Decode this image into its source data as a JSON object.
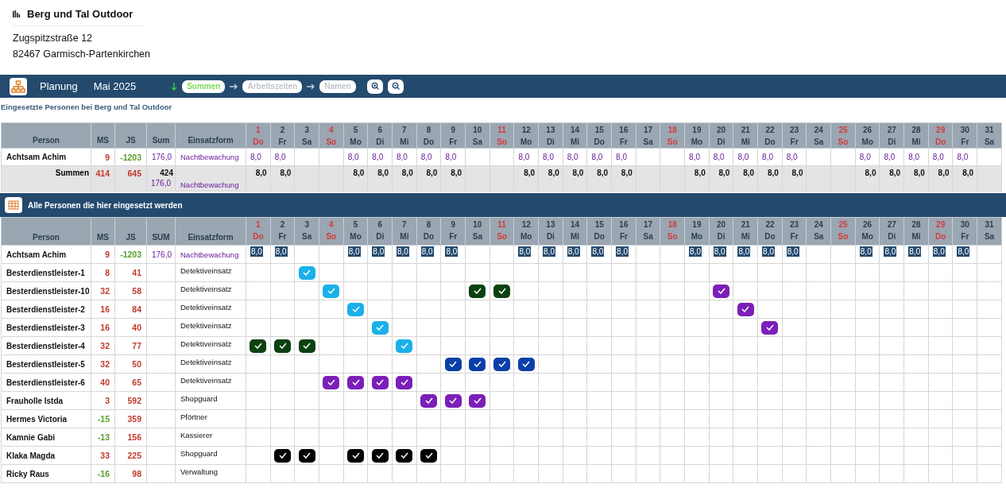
{
  "company": {
    "name": "Berg und Tal Outdoor",
    "address": [
      "Zugspitzstraße 12",
      "82467 Garmisch-Partenkirchen"
    ]
  },
  "toolbar": {
    "title": "Planung",
    "period": "Mai 2025",
    "steps": [
      {
        "label": "Summen",
        "selected": true
      },
      {
        "label": "Arbeitszeiten",
        "selected": false
      },
      {
        "label": "Namen",
        "selected": false
      }
    ]
  },
  "subtitle": "Eingesetzte Personen bei Berg und Tal Outdoor",
  "table1": {
    "columns": [
      "Person",
      "MS",
      "JS",
      "Sum",
      "Einsatzform"
    ],
    "days": [
      {
        "num": "1",
        "weekday": "Do",
        "holiday": true
      },
      {
        "num": "2",
        "weekday": "Fr",
        "holiday": false
      },
      {
        "num": "3",
        "weekday": "Sa",
        "holiday": false
      },
      {
        "num": "4",
        "weekday": "So",
        "holiday": true
      },
      {
        "num": "5",
        "weekday": "Mo",
        "holiday": false
      },
      {
        "num": "6",
        "weekday": "Di",
        "holiday": false
      },
      {
        "num": "7",
        "weekday": "Mi",
        "holiday": false
      },
      {
        "num": "8",
        "weekday": "Do",
        "holiday": false
      },
      {
        "num": "9",
        "weekday": "Fr",
        "holiday": false
      },
      {
        "num": "10",
        "weekday": "Sa",
        "holiday": false
      },
      {
        "num": "11",
        "weekday": "So",
        "holiday": true
      },
      {
        "num": "12",
        "weekday": "Mo",
        "holiday": false
      },
      {
        "num": "13",
        "weekday": "Di",
        "holiday": false
      },
      {
        "num": "14",
        "weekday": "Mi",
        "holiday": false
      },
      {
        "num": "15",
        "weekday": "Do",
        "holiday": false
      },
      {
        "num": "16",
        "weekday": "Fr",
        "holiday": false
      },
      {
        "num": "17",
        "weekday": "Sa",
        "holiday": false
      },
      {
        "num": "18",
        "weekday": "So",
        "holiday": true
      },
      {
        "num": "19",
        "weekday": "Mo",
        "holiday": false
      },
      {
        "num": "20",
        "weekday": "Di",
        "holiday": false
      },
      {
        "num": "21",
        "weekday": "Mi",
        "holiday": false
      },
      {
        "num": "22",
        "weekday": "Do",
        "holiday": false
      },
      {
        "num": "23",
        "weekday": "Fr",
        "holiday": false
      },
      {
        "num": "24",
        "weekday": "Sa",
        "holiday": false
      },
      {
        "num": "25",
        "weekday": "So",
        "holiday": true
      },
      {
        "num": "26",
        "weekday": "Mo",
        "holiday": false
      },
      {
        "num": "27",
        "weekday": "Di",
        "holiday": false
      },
      {
        "num": "28",
        "weekday": "Mi",
        "holiday": false
      },
      {
        "num": "29",
        "weekday": "Do",
        "holiday": true
      },
      {
        "num": "30",
        "weekday": "Fr",
        "holiday": false
      },
      {
        "num": "31",
        "weekday": "Sa",
        "holiday": false
      }
    ],
    "rows": [
      {
        "person": "Achtsam Achim",
        "ms": "9",
        "ms_negative": false,
        "js": "-1203",
        "js_negative": true,
        "sum": "176,0",
        "form": "Nachtbewachung",
        "cells": [
          {
            "kind": "hours",
            "text": "8,0"
          },
          {
            "kind": "hours",
            "text": "8,0"
          },
          {
            "kind": "empty"
          },
          {
            "kind": "empty"
          },
          {
            "kind": "hours",
            "text": "8,0"
          },
          {
            "kind": "hours",
            "text": "8,0"
          },
          {
            "kind": "hours",
            "text": "8,0"
          },
          {
            "kind": "hours",
            "text": "8,0"
          },
          {
            "kind": "hours",
            "text": "8,0"
          },
          {
            "kind": "empty"
          },
          {
            "kind": "empty"
          },
          {
            "kind": "hours",
            "text": "8,0"
          },
          {
            "kind": "hours",
            "text": "8,0"
          },
          {
            "kind": "hours",
            "text": "8,0"
          },
          {
            "kind": "hours",
            "text": "8,0"
          },
          {
            "kind": "hours",
            "text": "8,0"
          },
          {
            "kind": "empty"
          },
          {
            "kind": "empty"
          },
          {
            "kind": "hours",
            "text": "8,0"
          },
          {
            "kind": "hours",
            "text": "8,0"
          },
          {
            "kind": "hours",
            "text": "8,0"
          },
          {
            "kind": "hours",
            "text": "8,0"
          },
          {
            "kind": "hours",
            "text": "8,0"
          },
          {
            "kind": "empty"
          },
          {
            "kind": "empty"
          },
          {
            "kind": "hours",
            "text": "8,0"
          },
          {
            "kind": "hours",
            "text": "8,0"
          },
          {
            "kind": "hours",
            "text": "8,0"
          },
          {
            "kind": "hours",
            "text": "8,0"
          },
          {
            "kind": "hours",
            "text": "8,0"
          },
          {
            "kind": "empty"
          }
        ]
      }
    ],
    "totals": {
      "label": "Summen",
      "ms": "414",
      "js": "645",
      "sum": "424",
      "sum_hours": "176,0",
      "form": "Nachtbewachung",
      "cells": [
        {
          "kind": "total",
          "text": "8,0"
        },
        {
          "kind": "total",
          "text": "8,0"
        },
        {
          "kind": "empty"
        },
        {
          "kind": "empty"
        },
        {
          "kind": "total",
          "text": "8,0"
        },
        {
          "kind": "total",
          "text": "8,0"
        },
        {
          "kind": "total",
          "text": "8,0"
        },
        {
          "kind": "total",
          "text": "8,0"
        },
        {
          "kind": "total",
          "text": "8,0"
        },
        {
          "kind": "empty"
        },
        {
          "kind": "empty"
        },
        {
          "kind": "total",
          "text": "8,0"
        },
        {
          "kind": "total",
          "text": "8,0"
        },
        {
          "kind": "total",
          "text": "8,0"
        },
        {
          "kind": "total",
          "text": "8,0"
        },
        {
          "kind": "total",
          "text": "8,0"
        },
        {
          "kind": "empty"
        },
        {
          "kind": "empty"
        },
        {
          "kind": "total",
          "text": "8,0"
        },
        {
          "kind": "total",
          "text": "8,0"
        },
        {
          "kind": "total",
          "text": "8,0"
        },
        {
          "kind": "total",
          "text": "8,0"
        },
        {
          "kind": "total",
          "text": "8,0"
        },
        {
          "kind": "empty"
        },
        {
          "kind": "empty"
        },
        {
          "kind": "total",
          "text": "8,0"
        },
        {
          "kind": "total",
          "text": "8,0"
        },
        {
          "kind": "total",
          "text": "8,0"
        },
        {
          "kind": "total",
          "text": "8,0"
        },
        {
          "kind": "total",
          "text": "8,0"
        },
        {
          "kind": "empty"
        }
      ]
    }
  },
  "section": {
    "title": "Alle Personen die hier eingesetzt werden"
  },
  "table2": {
    "columns": [
      "Person",
      "MS",
      "JS",
      "SUM",
      "Einsatzform"
    ],
    "days": [
      {
        "num": "1",
        "weekday": "Do",
        "holiday": true
      },
      {
        "num": "2",
        "weekday": "Fr",
        "holiday": false
      },
      {
        "num": "3",
        "weekday": "Sa",
        "holiday": false
      },
      {
        "num": "4",
        "weekday": "So",
        "holiday": true
      },
      {
        "num": "5",
        "weekday": "Mo",
        "holiday": false
      },
      {
        "num": "6",
        "weekday": "Di",
        "holiday": false
      },
      {
        "num": "7",
        "weekday": "Mi",
        "holiday": false
      },
      {
        "num": "8",
        "weekday": "Do",
        "holiday": false
      },
      {
        "num": "9",
        "weekday": "Fr",
        "holiday": false
      },
      {
        "num": "10",
        "weekday": "Sa",
        "holiday": false
      },
      {
        "num": "11",
        "weekday": "So",
        "holiday": true
      },
      {
        "num": "12",
        "weekday": "Mo",
        "holiday": false
      },
      {
        "num": "13",
        "weekday": "Di",
        "holiday": false
      },
      {
        "num": "14",
        "weekday": "Mi",
        "holiday": false
      },
      {
        "num": "15",
        "weekday": "Do",
        "holiday": false
      },
      {
        "num": "16",
        "weekday": "Fr",
        "holiday": false
      },
      {
        "num": "17",
        "weekday": "Sa",
        "holiday": false
      },
      {
        "num": "18",
        "weekday": "So",
        "holiday": true
      },
      {
        "num": "19",
        "weekday": "Mo",
        "holiday": false
      },
      {
        "num": "20",
        "weekday": "Di",
        "holiday": false
      },
      {
        "num": "21",
        "weekday": "Mi",
        "holiday": false
      },
      {
        "num": "22",
        "weekday": "Do",
        "holiday": false
      },
      {
        "num": "23",
        "weekday": "Fr",
        "holiday": false
      },
      {
        "num": "24",
        "weekday": "Sa",
        "holiday": false
      },
      {
        "num": "25",
        "weekday": "So",
        "holiday": true
      },
      {
        "num": "26",
        "weekday": "Mo",
        "holiday": false
      },
      {
        "num": "27",
        "weekday": "Di",
        "holiday": false
      },
      {
        "num": "28",
        "weekday": "Mi",
        "holiday": false
      },
      {
        "num": "29",
        "weekday": "Do",
        "holiday": true
      },
      {
        "num": "30",
        "weekday": "Fr",
        "holiday": false
      },
      {
        "num": "31",
        "weekday": "Sa",
        "holiday": false
      }
    ],
    "rows": [
      {
        "person": "Achtsam Achim",
        "ms": "9",
        "ms_negative": false,
        "js": "-1203",
        "js_negative": true,
        "sum": "176,0",
        "form": "Nachtbewachung",
        "cells": [
          {
            "kind": "badge",
            "text": "8,0"
          },
          {
            "kind": "badge",
            "text": "8,0"
          },
          {
            "kind": "empty"
          },
          {
            "kind": "empty"
          },
          {
            "kind": "badge",
            "text": "8,0"
          },
          {
            "kind": "badge",
            "text": "8,0"
          },
          {
            "kind": "badge",
            "text": "8,0"
          },
          {
            "kind": "badge",
            "text": "8,0"
          },
          {
            "kind": "badge",
            "text": "8,0"
          },
          {
            "kind": "empty"
          },
          {
            "kind": "empty"
          },
          {
            "kind": "badge",
            "text": "8,0"
          },
          {
            "kind": "badge",
            "text": "8,0"
          },
          {
            "kind": "badge",
            "text": "8,0"
          },
          {
            "kind": "badge",
            "text": "8,0"
          },
          {
            "kind": "badge",
            "text": "8,0"
          },
          {
            "kind": "empty"
          },
          {
            "kind": "empty"
          },
          {
            "kind": "badge",
            "text": "8,0"
          },
          {
            "kind": "badge",
            "text": "8,0"
          },
          {
            "kind": "badge",
            "text": "8,0"
          },
          {
            "kind": "badge",
            "text": "8,0"
          },
          {
            "kind": "badge",
            "text": "8,0"
          },
          {
            "kind": "empty"
          },
          {
            "kind": "empty"
          },
          {
            "kind": "badge",
            "text": "8,0"
          },
          {
            "kind": "badge",
            "text": "8,0"
          },
          {
            "kind": "badge",
            "text": "8,0"
          },
          {
            "kind": "badge",
            "text": "8,0"
          },
          {
            "kind": "badge",
            "text": "8,0"
          },
          {
            "kind": "empty"
          }
        ]
      },
      {
        "person": "Besterdienstleister-1",
        "ms": "8",
        "ms_negative": false,
        "js": "41",
        "js_negative": false,
        "form": "Detektiveinsatz",
        "cells": [
          {
            "kind": "empty"
          },
          {
            "kind": "empty"
          },
          {
            "kind": "check",
            "color": "#1ab0ea"
          },
          {
            "kind": "empty"
          },
          {
            "kind": "empty"
          },
          {
            "kind": "empty"
          },
          {
            "kind": "empty"
          },
          {
            "kind": "empty"
          },
          {
            "kind": "empty"
          },
          {
            "kind": "empty"
          },
          {
            "kind": "empty"
          },
          {
            "kind": "empty"
          },
          {
            "kind": "empty"
          },
          {
            "kind": "empty"
          },
          {
            "kind": "empty"
          },
          {
            "kind": "empty"
          },
          {
            "kind": "empty"
          },
          {
            "kind": "empty"
          },
          {
            "kind": "empty"
          },
          {
            "kind": "empty"
          },
          {
            "kind": "empty"
          },
          {
            "kind": "empty"
          },
          {
            "kind": "empty"
          },
          {
            "kind": "empty"
          },
          {
            "kind": "empty"
          },
          {
            "kind": "empty"
          },
          {
            "kind": "empty"
          },
          {
            "kind": "empty"
          },
          {
            "kind": "empty"
          },
          {
            "kind": "empty"
          },
          {
            "kind": "empty"
          }
        ]
      },
      {
        "person": "Besterdienstleister-10",
        "ms": "32",
        "ms_negative": false,
        "js": "58",
        "js_negative": false,
        "form": "Detektiveinsatz",
        "cells": [
          {
            "kind": "empty"
          },
          {
            "kind": "empty"
          },
          {
            "kind": "empty"
          },
          {
            "kind": "check",
            "color": "#1ab0ea"
          },
          {
            "kind": "empty"
          },
          {
            "kind": "empty"
          },
          {
            "kind": "empty"
          },
          {
            "kind": "empty"
          },
          {
            "kind": "empty"
          },
          {
            "kind": "check",
            "color": "#0b4210"
          },
          {
            "kind": "check",
            "color": "#0b4210"
          },
          {
            "kind": "empty"
          },
          {
            "kind": "empty"
          },
          {
            "kind": "empty"
          },
          {
            "kind": "empty"
          },
          {
            "kind": "empty"
          },
          {
            "kind": "empty"
          },
          {
            "kind": "empty"
          },
          {
            "kind": "empty"
          },
          {
            "kind": "check",
            "color": "#7b1fb8"
          },
          {
            "kind": "empty"
          },
          {
            "kind": "empty"
          },
          {
            "kind": "empty"
          },
          {
            "kind": "empty"
          },
          {
            "kind": "empty"
          },
          {
            "kind": "empty"
          },
          {
            "kind": "empty"
          },
          {
            "kind": "empty"
          },
          {
            "kind": "empty"
          },
          {
            "kind": "empty"
          },
          {
            "kind": "empty"
          }
        ]
      },
      {
        "person": "Besterdienstleister-2",
        "ms": "16",
        "ms_negative": false,
        "js": "84",
        "js_negative": false,
        "form": "Detektiveinsatz",
        "cells": [
          {
            "kind": "empty"
          },
          {
            "kind": "empty"
          },
          {
            "kind": "empty"
          },
          {
            "kind": "empty"
          },
          {
            "kind": "check",
            "color": "#1ab0ea"
          },
          {
            "kind": "empty"
          },
          {
            "kind": "empty"
          },
          {
            "kind": "empty"
          },
          {
            "kind": "empty"
          },
          {
            "kind": "empty"
          },
          {
            "kind": "empty"
          },
          {
            "kind": "empty"
          },
          {
            "kind": "empty"
          },
          {
            "kind": "empty"
          },
          {
            "kind": "empty"
          },
          {
            "kind": "empty"
          },
          {
            "kind": "empty"
          },
          {
            "kind": "empty"
          },
          {
            "kind": "empty"
          },
          {
            "kind": "empty"
          },
          {
            "kind": "check",
            "color": "#7b1fb8"
          },
          {
            "kind": "empty"
          },
          {
            "kind": "empty"
          },
          {
            "kind": "empty"
          },
          {
            "kind": "empty"
          },
          {
            "kind": "empty"
          },
          {
            "kind": "empty"
          },
          {
            "kind": "empty"
          },
          {
            "kind": "empty"
          },
          {
            "kind": "empty"
          },
          {
            "kind": "empty"
          }
        ]
      },
      {
        "person": "Besterdienstleister-3",
        "ms": "16",
        "ms_negative": false,
        "js": "40",
        "js_negative": false,
        "form": "Detektiveinsatz",
        "cells": [
          {
            "kind": "empty"
          },
          {
            "kind": "empty"
          },
          {
            "kind": "empty"
          },
          {
            "kind": "empty"
          },
          {
            "kind": "empty"
          },
          {
            "kind": "check",
            "color": "#1ab0ea"
          },
          {
            "kind": "empty"
          },
          {
            "kind": "empty"
          },
          {
            "kind": "empty"
          },
          {
            "kind": "empty"
          },
          {
            "kind": "empty"
          },
          {
            "kind": "empty"
          },
          {
            "kind": "empty"
          },
          {
            "kind": "empty"
          },
          {
            "kind": "empty"
          },
          {
            "kind": "empty"
          },
          {
            "kind": "empty"
          },
          {
            "kind": "empty"
          },
          {
            "kind": "empty"
          },
          {
            "kind": "empty"
          },
          {
            "kind": "empty"
          },
          {
            "kind": "check",
            "color": "#7b1fb8"
          },
          {
            "kind": "empty"
          },
          {
            "kind": "empty"
          },
          {
            "kind": "empty"
          },
          {
            "kind": "empty"
          },
          {
            "kind": "empty"
          },
          {
            "kind": "empty"
          },
          {
            "kind": "empty"
          },
          {
            "kind": "empty"
          },
          {
            "kind": "empty"
          }
        ]
      },
      {
        "person": "Besterdienstleister-4",
        "ms": "32",
        "ms_negative": false,
        "js": "77",
        "js_negative": false,
        "form": "Detektiveinsatz",
        "cells": [
          {
            "kind": "check",
            "color": "#0b4210"
          },
          {
            "kind": "check",
            "color": "#0b4210"
          },
          {
            "kind": "check",
            "color": "#0b4210"
          },
          {
            "kind": "empty"
          },
          {
            "kind": "empty"
          },
          {
            "kind": "empty"
          },
          {
            "kind": "check",
            "color": "#1ab0ea"
          },
          {
            "kind": "empty"
          },
          {
            "kind": "empty"
          },
          {
            "kind": "empty"
          },
          {
            "kind": "empty"
          },
          {
            "kind": "empty"
          },
          {
            "kind": "empty"
          },
          {
            "kind": "empty"
          },
          {
            "kind": "empty"
          },
          {
            "kind": "empty"
          },
          {
            "kind": "empty"
          },
          {
            "kind": "empty"
          },
          {
            "kind": "empty"
          },
          {
            "kind": "empty"
          },
          {
            "kind": "empty"
          },
          {
            "kind": "empty"
          },
          {
            "kind": "empty"
          },
          {
            "kind": "empty"
          },
          {
            "kind": "empty"
          },
          {
            "kind": "empty"
          },
          {
            "kind": "empty"
          },
          {
            "kind": "empty"
          },
          {
            "kind": "empty"
          },
          {
            "kind": "empty"
          },
          {
            "kind": "empty"
          }
        ]
      },
      {
        "person": "Besterdienstleister-5",
        "ms": "32",
        "ms_negative": false,
        "js": "50",
        "js_negative": false,
        "form": "Detektiveinsatz",
        "cells": [
          {
            "kind": "empty"
          },
          {
            "kind": "empty"
          },
          {
            "kind": "empty"
          },
          {
            "kind": "empty"
          },
          {
            "kind": "empty"
          },
          {
            "kind": "empty"
          },
          {
            "kind": "empty"
          },
          {
            "kind": "empty"
          },
          {
            "kind": "check",
            "color": "#0a3fa8"
          },
          {
            "kind": "check",
            "color": "#0a3fa8"
          },
          {
            "kind": "check",
            "color": "#0a3fa8"
          },
          {
            "kind": "check",
            "color": "#0a3fa8"
          },
          {
            "kind": "empty"
          },
          {
            "kind": "empty"
          },
          {
            "kind": "empty"
          },
          {
            "kind": "empty"
          },
          {
            "kind": "empty"
          },
          {
            "kind": "empty"
          },
          {
            "kind": "empty"
          },
          {
            "kind": "empty"
          },
          {
            "kind": "empty"
          },
          {
            "kind": "empty"
          },
          {
            "kind": "empty"
          },
          {
            "kind": "empty"
          },
          {
            "kind": "empty"
          },
          {
            "kind": "empty"
          },
          {
            "kind": "empty"
          },
          {
            "kind": "empty"
          },
          {
            "kind": "empty"
          },
          {
            "kind": "empty"
          },
          {
            "kind": "empty"
          }
        ]
      },
      {
        "person": "Besterdienstleister-6",
        "ms": "40",
        "ms_negative": false,
        "js": "65",
        "js_negative": false,
        "form": "Detektiveinsatz",
        "cells": [
          {
            "kind": "empty"
          },
          {
            "kind": "empty"
          },
          {
            "kind": "empty"
          },
          {
            "kind": "check",
            "color": "#7b1fb8"
          },
          {
            "kind": "check",
            "color": "#7b1fb8"
          },
          {
            "kind": "check",
            "color": "#7b1fb8"
          },
          {
            "kind": "check",
            "color": "#7b1fb8"
          },
          {
            "kind": "empty"
          },
          {
            "kind": "empty"
          },
          {
            "kind": "empty"
          },
          {
            "kind": "empty"
          },
          {
            "kind": "empty"
          },
          {
            "kind": "empty"
          },
          {
            "kind": "empty"
          },
          {
            "kind": "empty"
          },
          {
            "kind": "empty"
          },
          {
            "kind": "empty"
          },
          {
            "kind": "empty"
          },
          {
            "kind": "empty"
          },
          {
            "kind": "empty"
          },
          {
            "kind": "empty"
          },
          {
            "kind": "empty"
          },
          {
            "kind": "empty"
          },
          {
            "kind": "empty"
          },
          {
            "kind": "empty"
          },
          {
            "kind": "empty"
          },
          {
            "kind": "empty"
          },
          {
            "kind": "empty"
          },
          {
            "kind": "empty"
          },
          {
            "kind": "empty"
          },
          {
            "kind": "empty"
          }
        ]
      },
      {
        "person": "Frauholle Istda",
        "ms": "3",
        "ms_negative": false,
        "js": "592",
        "js_negative": false,
        "form": "Shopguard",
        "cells": [
          {
            "kind": "empty"
          },
          {
            "kind": "empty"
          },
          {
            "kind": "empty"
          },
          {
            "kind": "empty"
          },
          {
            "kind": "empty"
          },
          {
            "kind": "empty"
          },
          {
            "kind": "empty"
          },
          {
            "kind": "check",
            "color": "#7b1fb8"
          },
          {
            "kind": "check",
            "color": "#7b1fb8"
          },
          {
            "kind": "check",
            "color": "#7b1fb8"
          },
          {
            "kind": "empty"
          },
          {
            "kind": "empty"
          },
          {
            "kind": "empty"
          },
          {
            "kind": "empty"
          },
          {
            "kind": "empty"
          },
          {
            "kind": "empty"
          },
          {
            "kind": "empty"
          },
          {
            "kind": "empty"
          },
          {
            "kind": "empty"
          },
          {
            "kind": "empty"
          },
          {
            "kind": "empty"
          },
          {
            "kind": "empty"
          },
          {
            "kind": "empty"
          },
          {
            "kind": "empty"
          },
          {
            "kind": "empty"
          },
          {
            "kind": "empty"
          },
          {
            "kind": "empty"
          },
          {
            "kind": "empty"
          },
          {
            "kind": "empty"
          },
          {
            "kind": "empty"
          },
          {
            "kind": "empty"
          }
        ]
      },
      {
        "person": "Hermes Victoria",
        "ms": "-15",
        "ms_negative": true,
        "js": "359",
        "js_negative": false,
        "form": "Pförtner",
        "cells": []
      },
      {
        "person": "Kamnie Gabi",
        "ms": "-13",
        "ms_negative": true,
        "js": "156",
        "js_negative": false,
        "form": "Kassierer",
        "cells": []
      },
      {
        "person": "Klaka Magda",
        "ms": "33",
        "ms_negative": false,
        "js": "225",
        "js_negative": false,
        "form": "Shopguard",
        "cells": [
          {
            "kind": "empty"
          },
          {
            "kind": "check",
            "color": "#000000"
          },
          {
            "kind": "check",
            "color": "#000000"
          },
          {
            "kind": "empty"
          },
          {
            "kind": "check",
            "color": "#000000"
          },
          {
            "kind": "check",
            "color": "#000000"
          },
          {
            "kind": "check",
            "color": "#000000"
          },
          {
            "kind": "check",
            "color": "#000000"
          },
          {
            "kind": "empty"
          },
          {
            "kind": "empty"
          },
          {
            "kind": "empty"
          },
          {
            "kind": "empty"
          },
          {
            "kind": "empty"
          },
          {
            "kind": "empty"
          },
          {
            "kind": "empty"
          },
          {
            "kind": "empty"
          },
          {
            "kind": "empty"
          },
          {
            "kind": "empty"
          },
          {
            "kind": "empty"
          },
          {
            "kind": "empty"
          },
          {
            "kind": "empty"
          },
          {
            "kind": "empty"
          },
          {
            "kind": "empty"
          },
          {
            "kind": "empty"
          },
          {
            "kind": "empty"
          },
          {
            "kind": "empty"
          },
          {
            "kind": "empty"
          },
          {
            "kind": "empty"
          },
          {
            "kind": "empty"
          },
          {
            "kind": "empty"
          },
          {
            "kind": "empty"
          }
        ]
      },
      {
        "person": "Ricky Raus",
        "ms": "-16",
        "ms_negative": true,
        "js": "98",
        "js_negative": false,
        "form": "Verwaltung",
        "cells": []
      }
    ]
  }
}
